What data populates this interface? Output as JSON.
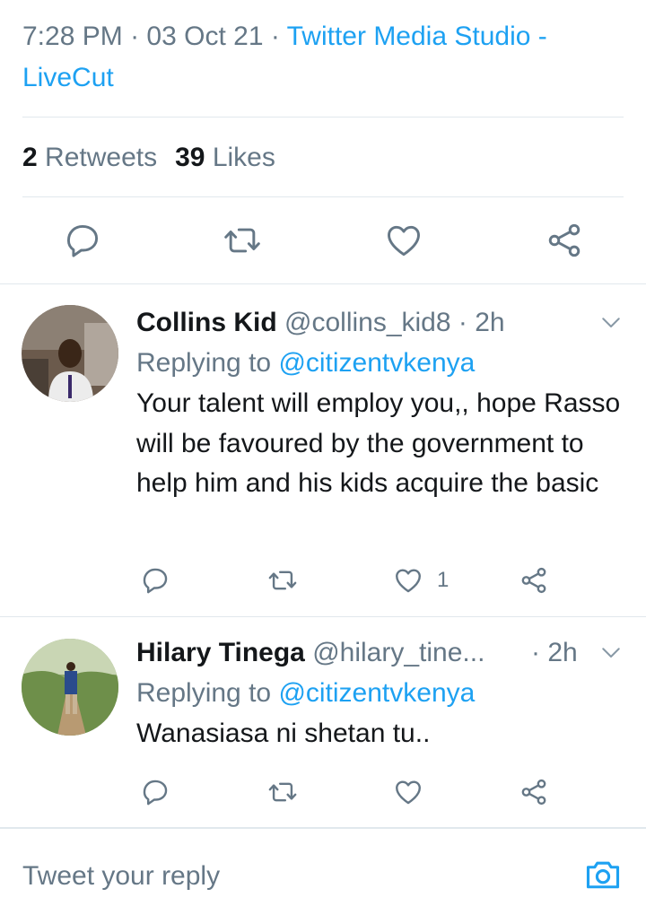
{
  "tweet": {
    "time": "7:28 PM",
    "date": "03 Oct 21",
    "separator": "·",
    "source": "Twitter Media Studio - LiveCut",
    "retweet_count": "2",
    "retweet_label": "Retweets",
    "like_count": "39",
    "like_label": "Likes"
  },
  "actions": {
    "reply_icon": "reply-icon",
    "retweet_icon": "retweet-icon",
    "like_icon": "heart-icon",
    "share_icon": "share-icon"
  },
  "replies": [
    {
      "name": "Collins Kid",
      "handle": "@collins_kid8",
      "time": "· 2h",
      "replying_label": "Replying to",
      "mention": "@citizentvkenya",
      "text": "Your talent will employ you,, hope Rasso will be favoured by the government to help him and his kids acquire the basic",
      "like_count": "1"
    },
    {
      "name": "Hilary Tinega",
      "handle": "@hilary_tine...",
      "time": "· 2h",
      "replying_label": "Replying to",
      "mention": "@citizentvkenya",
      "text": "Wanasiasa ni shetan tu..",
      "like_count": ""
    }
  ],
  "composer": {
    "placeholder": "Tweet your reply",
    "camera_icon": "camera-icon"
  },
  "colors": {
    "accent": "#1da1f2",
    "secondary_text": "#657786",
    "primary_text": "#14171a",
    "divider": "#e1e8ed"
  }
}
